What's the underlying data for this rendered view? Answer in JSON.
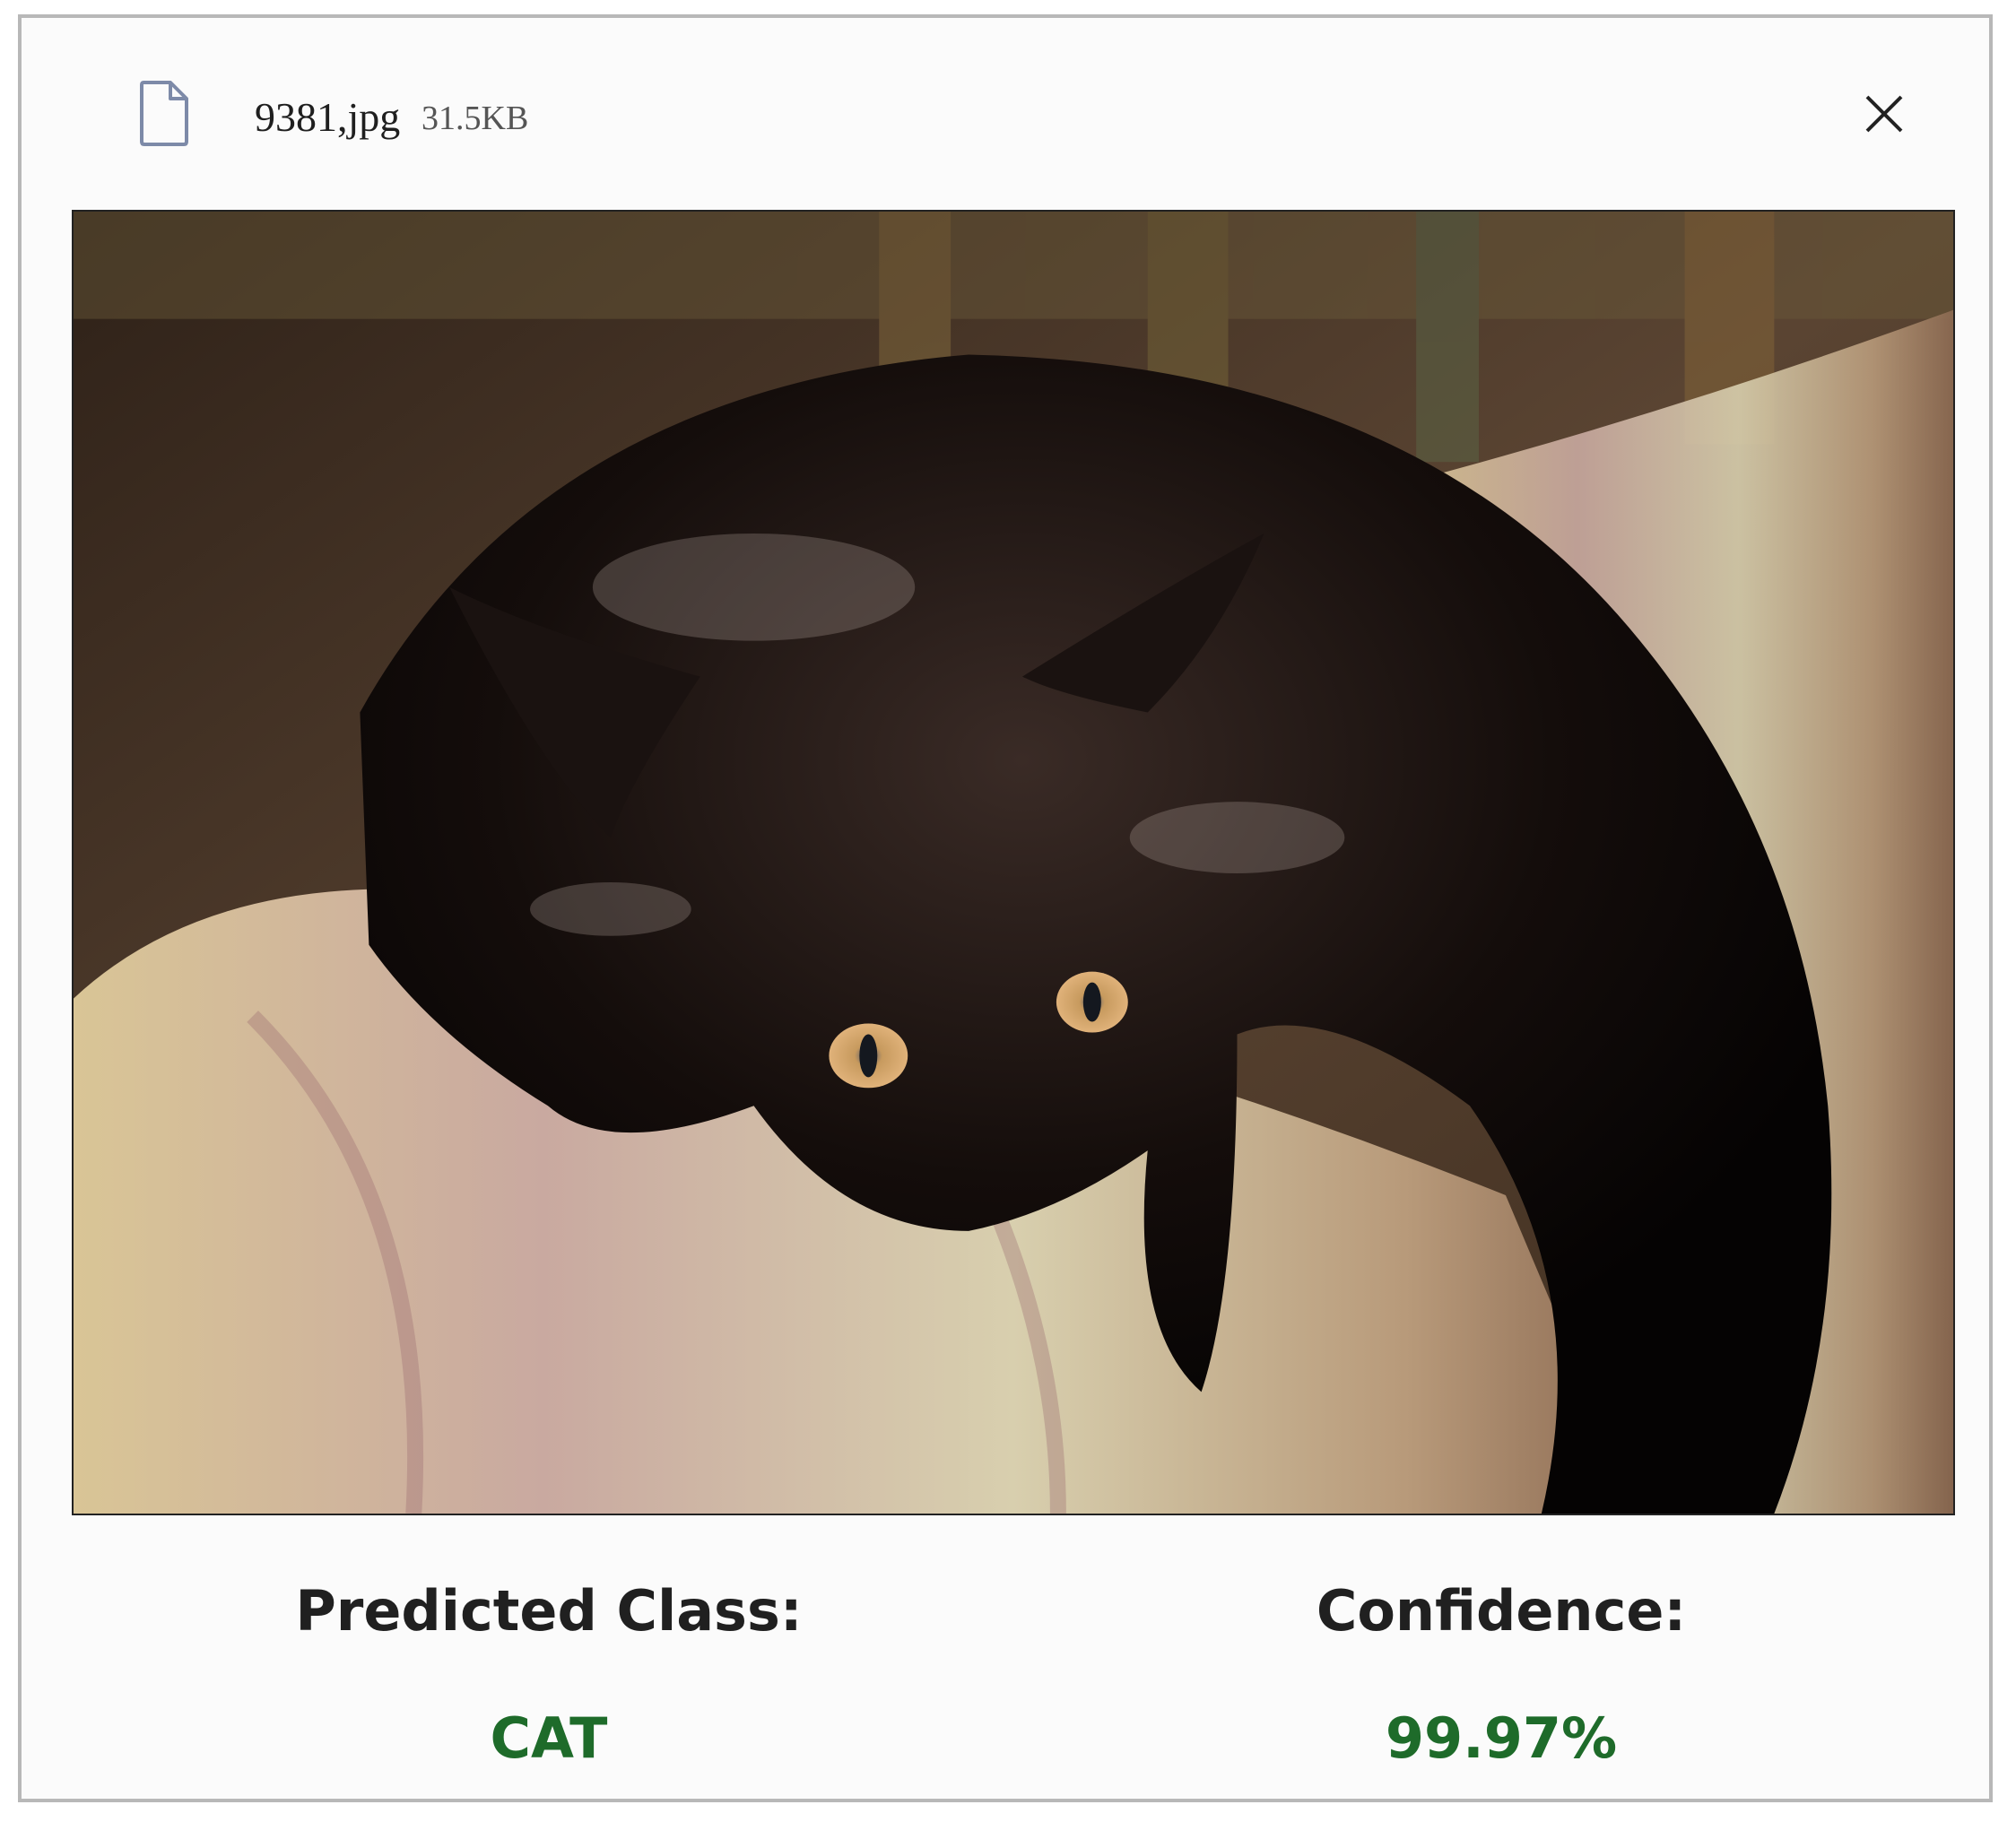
{
  "file": {
    "name": "9381,jpg",
    "size": "31.5KB",
    "icon": "file-icon"
  },
  "close_icon": "close-icon",
  "image": {
    "subject": "black cat on patterned sofa"
  },
  "result": {
    "predicted_label": "Predicted Class:",
    "predicted_value": "CAT",
    "confidence_label": "Confidence:",
    "confidence_value": "99.97%"
  },
  "colors": {
    "result_value": "#1e6b2a",
    "label": "#202020",
    "icon": "#7d8aa8"
  }
}
